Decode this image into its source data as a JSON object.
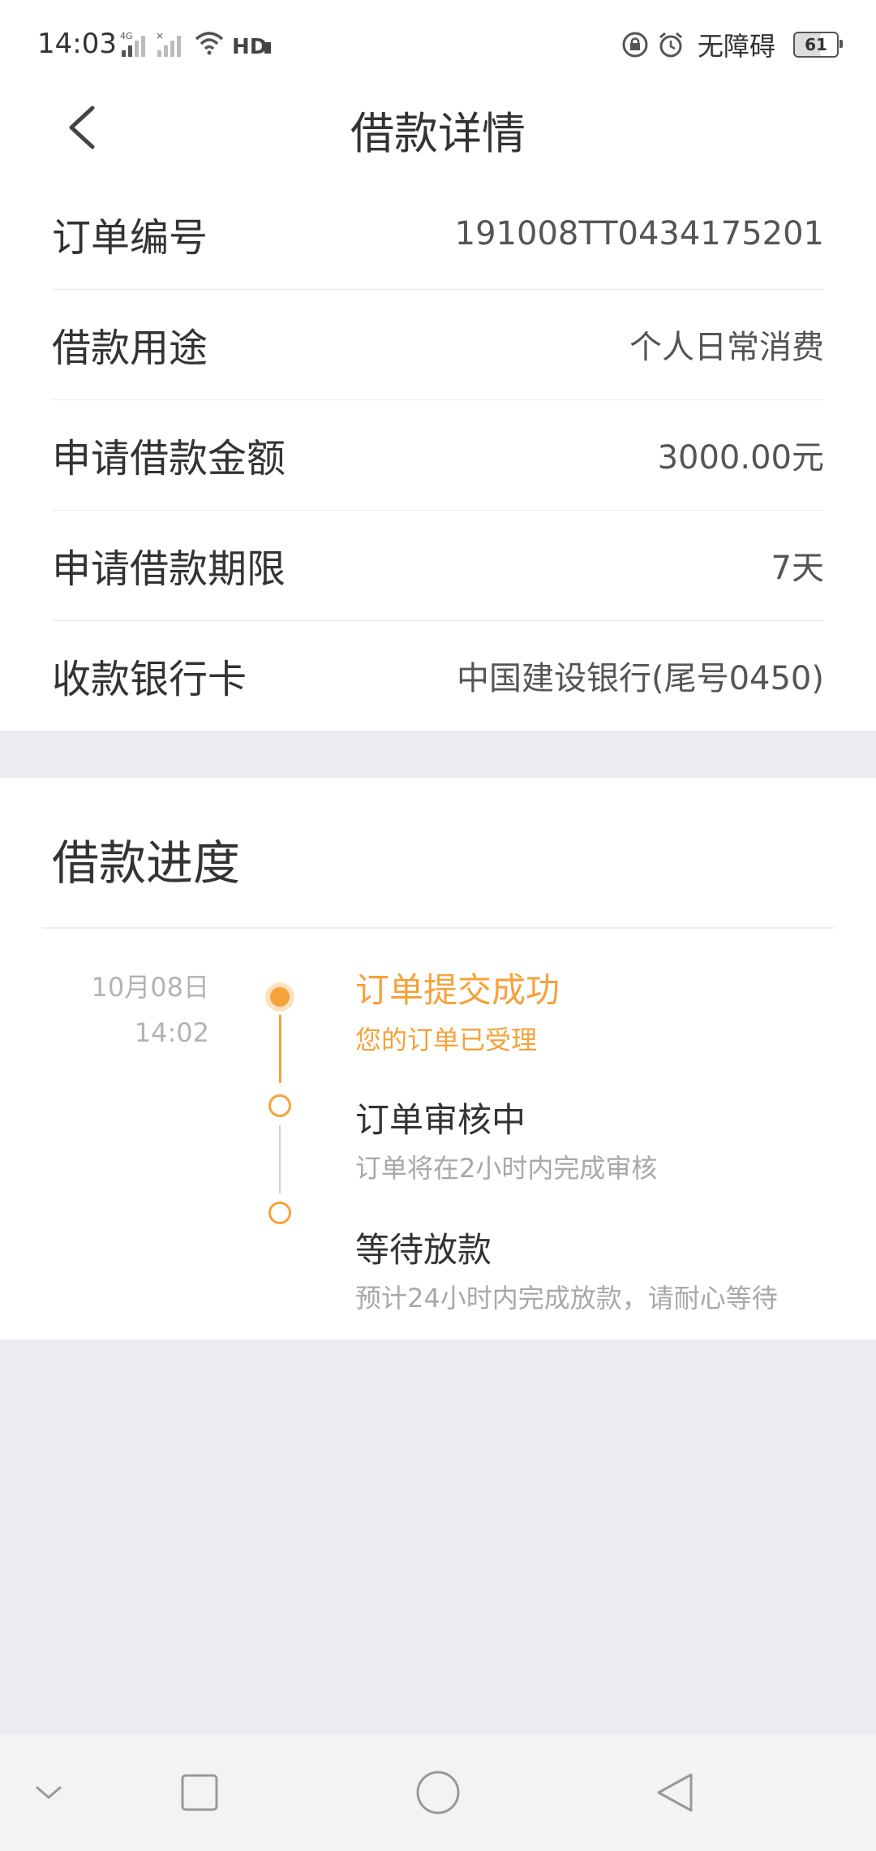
{
  "status_bar": {
    "time": "14:03",
    "accessibility_label": "无障碍",
    "battery_level": "61",
    "icons": [
      "signal-4g-icon",
      "signal-x-icon",
      "wifi-icon",
      "hd-icon",
      "lock-rotation-icon",
      "alarm-icon",
      "battery-icon"
    ]
  },
  "header": {
    "title": "借款详情",
    "back_icon": "chevron-left-icon"
  },
  "info": {
    "order_no_label": "订单编号",
    "order_no_value": "191008TT0434175201",
    "purpose_label": "借款用途",
    "purpose_value": "个人日常消费",
    "amount_label": "申请借款金额",
    "amount_value": "3000.00元",
    "term_label": "申请借款期限",
    "term_value": "7天",
    "card_label": "收款银行卡",
    "card_value": "中国建设银行(尾号0450)"
  },
  "progress": {
    "title": "借款进度",
    "date": "10月08日",
    "time": "14:02",
    "steps": [
      {
        "title": "订单提交成功",
        "desc": "您的订单已受理",
        "status": "done"
      },
      {
        "title": "订单审核中",
        "desc": "订单将在2小时内完成审核",
        "status": "pending"
      },
      {
        "title": "等待放款",
        "desc": "预计24小时内完成放款，请耐心等待",
        "status": "pending"
      }
    ],
    "accent_color": "#f5a23a"
  },
  "nav_bar": {
    "icons": [
      "chevron-down-icon",
      "square-icon",
      "circle-icon",
      "triangle-back-icon"
    ]
  }
}
